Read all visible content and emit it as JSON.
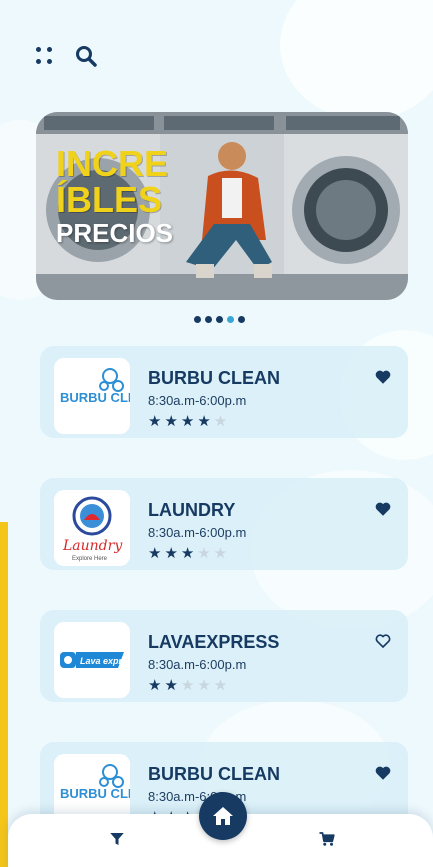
{
  "banner": {
    "line1": "INCRE",
    "line2": "ÍBLES",
    "line3": "PRECIOS"
  },
  "carousel": {
    "count": 5,
    "active_index": 3
  },
  "colors": {
    "navy": "#173a63",
    "accent_blue": "#3aa6d6",
    "yellow": "#f4c61a"
  },
  "icons": [
    "apps-dots-icon",
    "search-icon",
    "heart-icon",
    "filter-icon",
    "home-icon",
    "cart-icon"
  ],
  "laundries": [
    {
      "name": "BURBU CLEAN",
      "hours": "8:30a.m-6:00p.m",
      "rating": 4,
      "favorite": true,
      "logo_text": "BURBU CLEAN"
    },
    {
      "name": "LAUNDRY",
      "hours": "8:30a.m-6:00p.m",
      "rating": 3,
      "favorite": true,
      "logo_text": "Laundry",
      "logo_subtext": "Explore Here"
    },
    {
      "name": "LAVAEXPRESS",
      "hours": "8:30a.m-6:00p.m",
      "rating": 2,
      "favorite": false,
      "logo_text": "Lava express"
    },
    {
      "name": "BURBU CLEAN",
      "hours": "8:30a.m-6:00p.m",
      "rating": 3,
      "favorite": true,
      "logo_text": "BURBU CLEAN"
    }
  ]
}
